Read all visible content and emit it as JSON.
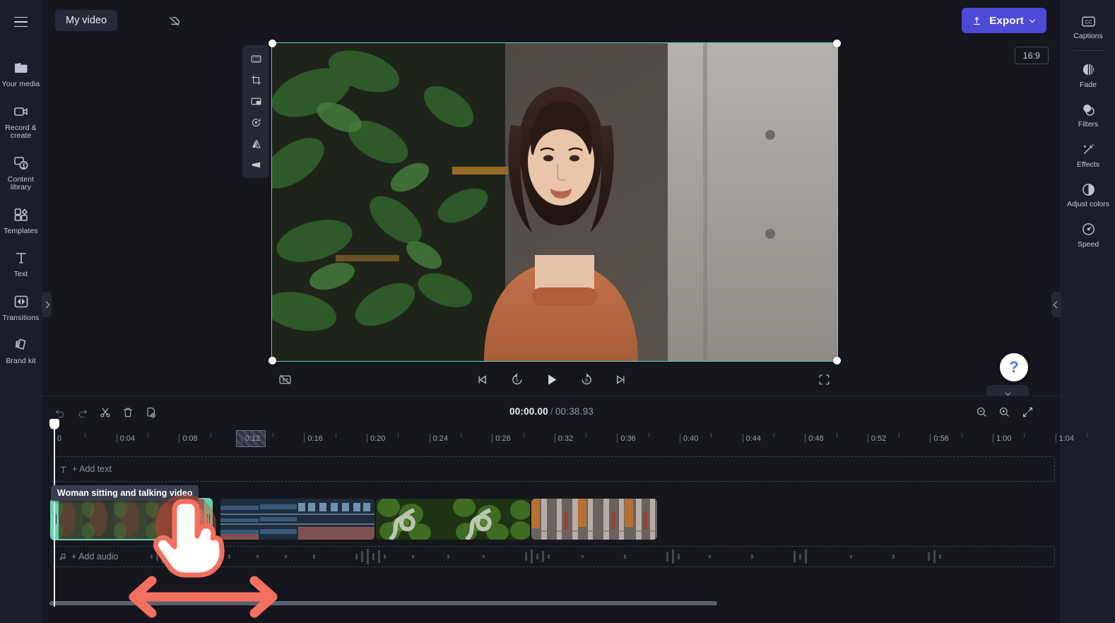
{
  "app": {
    "project_title": "My video",
    "cloud_status_icon": "cloud-off-icon"
  },
  "topbar": {
    "export_label": "Export",
    "export_icon": "upload-arrow-icon",
    "export_color": "#4d4ad8",
    "menu_icon": "hamburger-menu-icon"
  },
  "left_sidebar": {
    "items": [
      {
        "label": "Your media",
        "icon": "folder-media-icon"
      },
      {
        "label": "Record & create",
        "icon": "video-camera-icon"
      },
      {
        "label": "Content library",
        "icon": "content-library-icon"
      },
      {
        "label": "Templates",
        "icon": "templates-grid-icon"
      },
      {
        "label": "Text",
        "icon": "text-t-icon"
      },
      {
        "label": "Transitions",
        "icon": "transitions-icon"
      },
      {
        "label": "Brand kit",
        "icon": "brand-kit-icon"
      }
    ]
  },
  "right_sidebar": {
    "items": [
      {
        "label": "Captions",
        "icon": "closed-caption-icon"
      },
      {
        "label": "Fade",
        "icon": "fade-icon"
      },
      {
        "label": "Filters",
        "icon": "filters-circles-icon"
      },
      {
        "label": "Effects",
        "icon": "effects-wand-icon"
      },
      {
        "label": "Adjust colors",
        "icon": "adjust-colors-icon"
      },
      {
        "label": "Speed",
        "icon": "speedometer-icon"
      }
    ]
  },
  "preview": {
    "aspect_ratio_label": "16:9",
    "selection_color": "#5fd9b0",
    "tools": [
      {
        "name": "fit-to-frame",
        "icon": "fit-to-frame-icon"
      },
      {
        "name": "crop",
        "icon": "crop-icon"
      },
      {
        "name": "picture-in-picture",
        "icon": "picture-in-picture-icon"
      },
      {
        "name": "rotate",
        "icon": "rotate-icon"
      },
      {
        "name": "flip-horizontal",
        "icon": "flip-horizontal-icon"
      },
      {
        "name": "skew",
        "icon": "skew-perspective-icon"
      }
    ],
    "playback": {
      "captions_off_icon": "captions-off-icon",
      "skip_back_icon": "skip-to-start-icon",
      "rewind_label": "5",
      "rewind_icon": "rewind-5-icon",
      "play_icon": "play-icon",
      "forward_label": "5",
      "forward_icon": "forward-5-icon",
      "skip_forward_icon": "skip-to-end-icon",
      "fullscreen_icon": "fullscreen-icon"
    },
    "help_label": "?",
    "collapse_icon": "chevron-down-icon"
  },
  "timeline": {
    "tools": [
      {
        "name": "undo",
        "icon": "undo-arrow-icon",
        "disabled": true
      },
      {
        "name": "redo",
        "icon": "redo-arrow-icon",
        "disabled": true
      },
      {
        "name": "split",
        "icon": "scissors-icon",
        "disabled": false
      },
      {
        "name": "delete",
        "icon": "trash-icon",
        "disabled": false
      },
      {
        "name": "duplicate",
        "icon": "duplicate-icon",
        "disabled": false
      }
    ],
    "zoom_tools": [
      {
        "name": "zoom-out",
        "icon": "magnifier-minus-icon"
      },
      {
        "name": "zoom-in",
        "icon": "magnifier-plus-icon"
      },
      {
        "name": "fit-timeline",
        "icon": "fit-arrows-icon"
      }
    ],
    "current_time": "00:00.00",
    "separator": "/",
    "total_time": "00:38.93",
    "ruler_labels": [
      "0",
      "0:04",
      "0:08",
      "0:12",
      "0:16",
      "0:20",
      "0:24",
      "0:28",
      "0:32",
      "0:36",
      "0:40",
      "0:44",
      "0:48",
      "0:52",
      "0:56",
      "1:00",
      "1:04"
    ],
    "text_track_hint": "+ Add text",
    "text_track_icon": "text-t-icon",
    "audio_track_hint": "+ Add audio",
    "audio_track_icon": "music-note-icon",
    "selected_clip_tooltip": "Woman sitting and talking video",
    "clips": [
      {
        "name": "woman-sitting-and-talking-video",
        "selected": true
      },
      {
        "name": "industrial-blue-clip",
        "selected": false
      },
      {
        "name": "forest-road-clip",
        "selected": false
      },
      {
        "name": "urban-street-clip",
        "selected": false
      }
    ]
  },
  "annotation": {
    "cursor_icon": "pointing-hand-cursor",
    "drag_arrow_icon": "horizontal-double-arrow",
    "accent_color": "#f4705e"
  }
}
